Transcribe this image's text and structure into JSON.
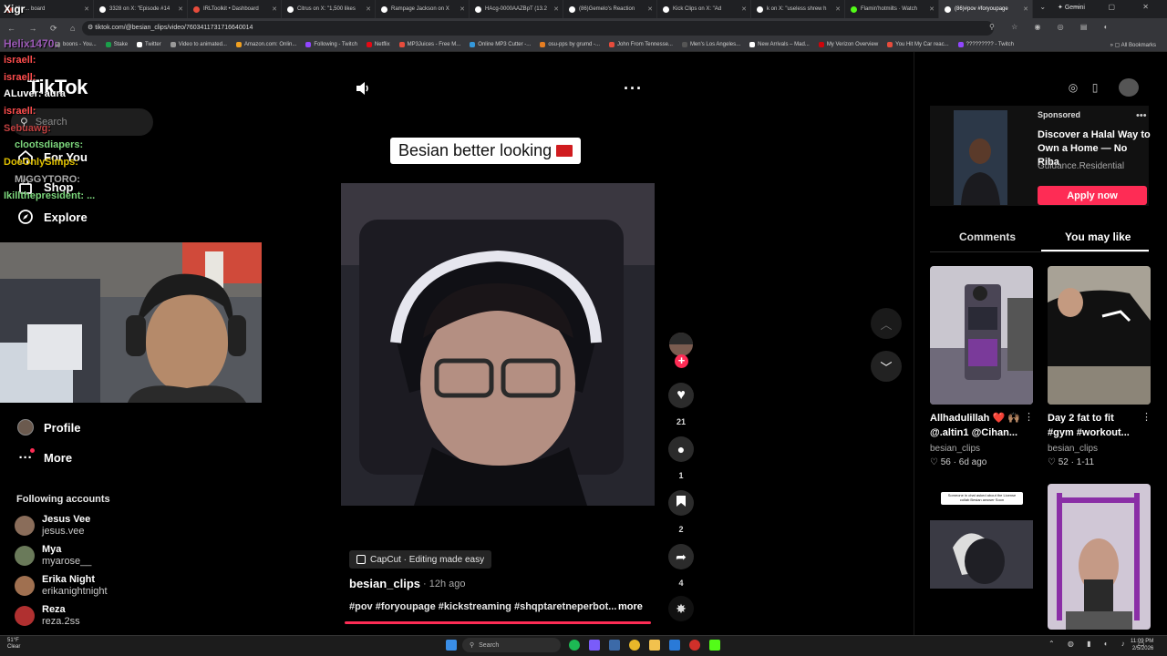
{
  "browser": {
    "tabs": [
      {
        "label": "Xigr... board",
        "color": "#c0392b"
      },
      {
        "label": "3328 on X: \"Episode #14",
        "color": "#ffffff"
      },
      {
        "label": "IRLToolkit • Dashboard",
        "color": "#e74c3c"
      },
      {
        "label": "Citrus on X: \"1,500 likes",
        "color": "#ffffff"
      },
      {
        "label": "Rampage Jackson on X",
        "color": "#ffffff"
      },
      {
        "label": "HAcg-0000AAZBpT (13.2",
        "color": "#ffffff"
      },
      {
        "label": "(86)Gemelo's Reaction",
        "color": "#ffffff"
      },
      {
        "label": "Kick Clips on X: \"Ad",
        "color": "#ffffff"
      },
      {
        "label": "k on X: \"useless shrew h",
        "color": "#ffffff"
      },
      {
        "label": "Flamin'hotmilts · Watch",
        "color": "#53fc18"
      },
      {
        "label": "(86)#pov #foryoupage",
        "color": "#ffffff"
      }
    ],
    "gemini_label": "Gemini",
    "url": "tiktok.com/@besian_clips/video/7603411731716640014",
    "bookmarks": [
      "boons - You...",
      "Stake",
      "Twitter",
      "Video to animated...",
      "Amazon.com: Onlin...",
      "Following - Twitch",
      "Netflix",
      "MP3Juices - Free M...",
      "Online MP3 Cutter -...",
      "osu-pps by grumd -...",
      "John From Tennesse...",
      "Men's Los Angeles...",
      "New Arrivals – Mad...",
      "My Verizon Overview",
      "You Hit My Car reac...",
      "????????? - Twitch"
    ],
    "all_bookmarks": "All Bookmarks"
  },
  "sidebar": {
    "logo": "TikTok",
    "search_placeholder": "Search",
    "nav": [
      {
        "label": "For You",
        "icon": "home-icon"
      },
      {
        "label": "Shop",
        "icon": "shop-icon"
      },
      {
        "label": "Explore",
        "icon": "compass-icon"
      },
      {
        "label": "Profile",
        "icon": "profile-icon"
      },
      {
        "label": "More",
        "icon": "more-dots-icon"
      }
    ],
    "following_header": "Following accounts",
    "accounts": [
      {
        "name": "Jesus Vee",
        "user": "jesus.vee",
        "color": "#8a6d5a"
      },
      {
        "name": "Mya",
        "user": "myarose__",
        "color": "#6a7a5a"
      },
      {
        "name": "Erika Night",
        "user": "erikanightnight",
        "color": "#a07050"
      },
      {
        "name": "Reza",
        "user": "reza.2ss",
        "color": "#b03030"
      }
    ]
  },
  "chat": [
    {
      "text": "Xigr",
      "color": "#ffffff"
    },
    {
      "text": "Helix1470:",
      "color": "#9b59b6"
    },
    {
      "text": "israell:",
      "color": "#ff4d4d"
    },
    {
      "text": "israell:",
      "color": "#ff4d4d"
    },
    {
      "text": "ALuver: aura",
      "color": "#ffffff"
    },
    {
      "text": "israell:",
      "color": "#ff4d4d"
    },
    {
      "text": "Sebuawg:",
      "color": "#c04040"
    },
    {
      "text": "clootsdiapers:",
      "color": "#7cd67c"
    },
    {
      "text": "DoeOnlySimps:",
      "color": "#e0c000"
    },
    {
      "text": "MIGGYTORO:",
      "color": "#aaaaaa"
    },
    {
      "text": "Ikillthepresident: ...",
      "color": "#7cd67c"
    }
  ],
  "video": {
    "caption_title": "Besian better looking",
    "capcut_label": "CapCut · Editing made easy",
    "author": "besian_clips",
    "posted": "12h ago",
    "hashtags": "#pov #foryoupage #kickstreaming #shqptaretneperbot...",
    "more": "more",
    "likes": "21",
    "comments": "1",
    "saves": "2",
    "shares": "4"
  },
  "right": {
    "sponsored": "Sponsored",
    "ad_title": "Discover a Halal Way to Own a Home — No Riba",
    "ad_sub": "Guidance.Residential",
    "apply": "Apply now",
    "tab_comments": "Comments",
    "tab_like": "You may like",
    "videos": [
      {
        "title": "Allhadulillah ❤️ 🙌🏽 @.altin1 @Cihan...",
        "user": "besian_clips",
        "stats": "♡ 56 · 6d ago"
      },
      {
        "title": "Day 2 fat to fit #gym #workout...",
        "user": "besian_clips",
        "stats": "♡ 52 · 1-11"
      }
    ],
    "thumb3_caption": "Someone in chat asked about the License collab Besian answer Soon"
  },
  "taskbar": {
    "temp": "51°F",
    "weather": "Clear",
    "search": "Search",
    "time": "11:09 PM",
    "date": "2/5/2026"
  }
}
